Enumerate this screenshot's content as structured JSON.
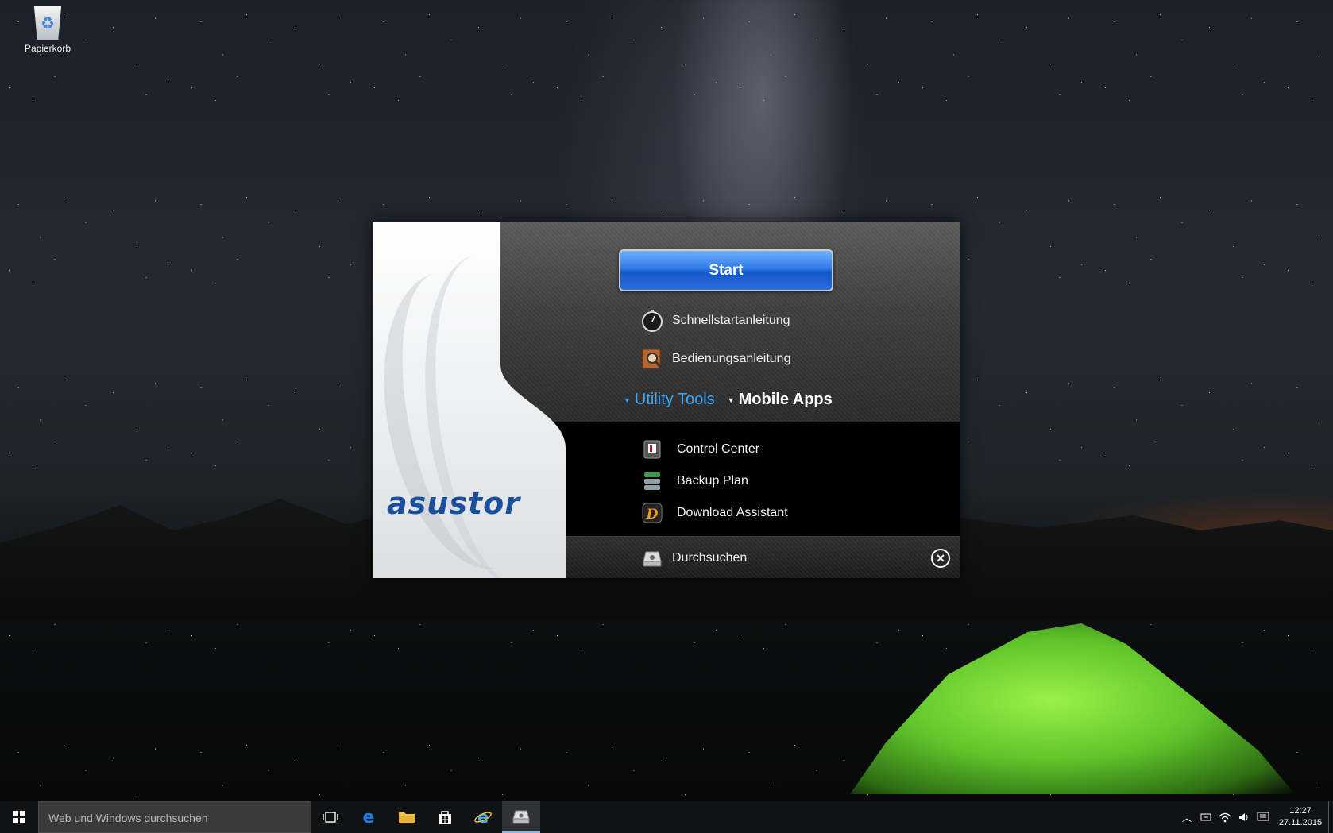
{
  "desktop": {
    "recycle_bin_label": "Papierkorb"
  },
  "dialog": {
    "logo": "asustor",
    "start_label": "Start",
    "links": {
      "quick_start": "Schnellstartanleitung",
      "manual": "Bedienungsanleitung"
    },
    "tabs": {
      "utility_tools": "Utility Tools",
      "mobile_apps": "Mobile Apps"
    },
    "utilities": [
      {
        "label": "Control Center",
        "icon": "control-center-icon"
      },
      {
        "label": "Backup Plan",
        "icon": "backup-plan-icon"
      },
      {
        "label": "Download Assistant",
        "icon": "download-assistant-icon"
      }
    ],
    "browse_label": "Durchsuchen"
  },
  "taskbar": {
    "search_placeholder": "Web und Windows durchsuchen",
    "clock_time": "12:27",
    "clock_date": "27.11.2015"
  },
  "colors": {
    "start_button": "#2f7be6",
    "active_tab": "#3aa6ff",
    "logo": "#1b4f9c"
  }
}
